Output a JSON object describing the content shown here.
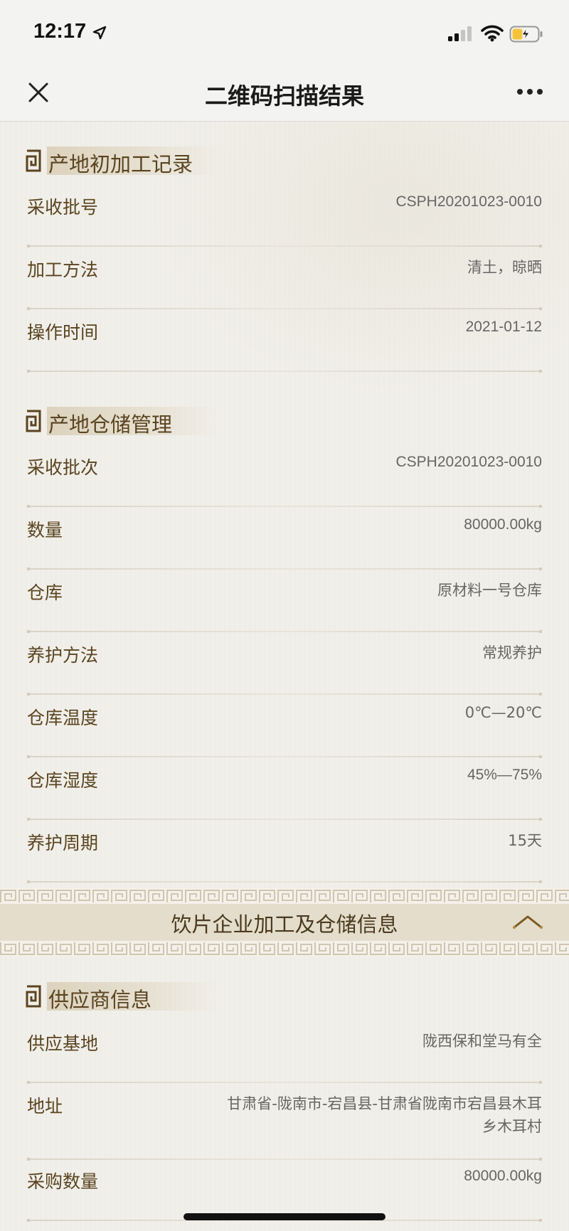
{
  "status": {
    "time": "12:17"
  },
  "nav": {
    "title": "二维码扫描结果",
    "close_icon": "close-icon",
    "more_icon": "more-icon"
  },
  "sections": [
    {
      "title": "产地初加工记录",
      "rows": [
        {
          "key": "采收批号",
          "value": "CSPH20201023-0010"
        },
        {
          "key": "加工方法",
          "value": "清土，晾晒"
        },
        {
          "key": "操作时间",
          "value": "2021-01-12"
        }
      ]
    },
    {
      "title": "产地仓储管理",
      "rows": [
        {
          "key": "采收批次",
          "value": "CSPH20201023-0010"
        },
        {
          "key": "数量",
          "value": "80000.00kg"
        },
        {
          "key": "仓库",
          "value": "原材料一号仓库"
        },
        {
          "key": "养护方法",
          "value": "常规养护"
        },
        {
          "key": "仓库温度",
          "value": "0℃—20℃"
        },
        {
          "key": "仓库湿度",
          "value": "45%—75%"
        },
        {
          "key": "养护周期",
          "value": "15天"
        }
      ]
    },
    {
      "title": "供应商信息",
      "rows": [
        {
          "key": "供应基地",
          "value": "陇西保和堂马有全"
        },
        {
          "key": "地址",
          "value_line1": "甘肃省-陇南市-宕昌县-甘肃省陇南市宕昌县木耳",
          "value_line2": "乡木耳村"
        },
        {
          "key": "采购数量",
          "value": "80000.00kg"
        }
      ]
    }
  ],
  "banner": {
    "title": "饮片企业加工及仓储信息",
    "toggle_icon": "chevron-up-icon"
  },
  "colors": {
    "text_brown": "#5a4420",
    "value_gray": "#666666",
    "background": "#f1efe9"
  }
}
